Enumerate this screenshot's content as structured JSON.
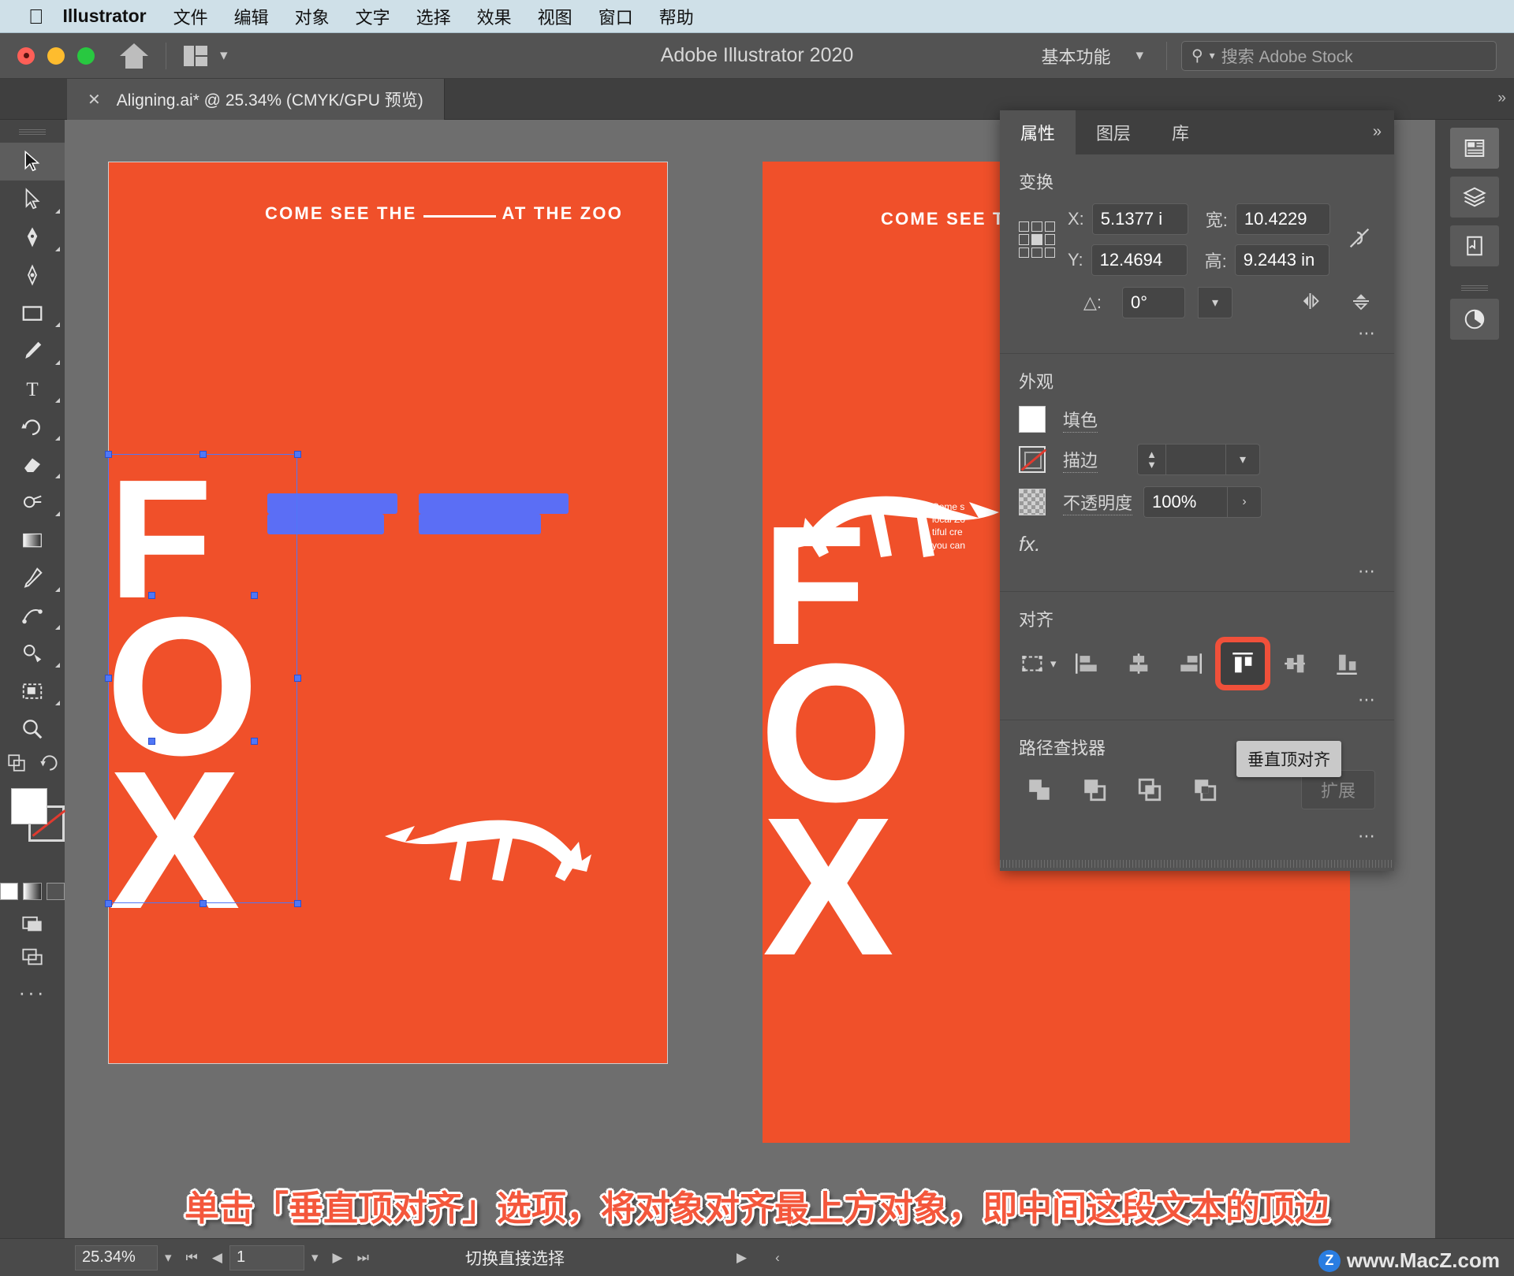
{
  "menubar": {
    "apple_icon": "apple-icon",
    "app_name": "Illustrator",
    "items": [
      "文件",
      "编辑",
      "对象",
      "文字",
      "选择",
      "效果",
      "视图",
      "窗口",
      "帮助"
    ]
  },
  "titlebar": {
    "app_title": "Adobe Illustrator 2020",
    "workspace": "基本功能",
    "search_placeholder": "搜索 Adobe Stock",
    "home_icon": "home-icon",
    "arrange_icon": "arrange-documents-icon",
    "search_icon": "search-icon"
  },
  "tabbar": {
    "document_tab": "Aligning.ai* @ 25.34% (CMYK/GPU 预览)",
    "close_icon": "close-icon"
  },
  "toolbar": {
    "tools": [
      {
        "name": "selection-tool",
        "selected": true
      },
      {
        "name": "direct-selection-tool",
        "selected": false
      },
      {
        "name": "pen-tool",
        "selected": false
      },
      {
        "name": "curvature-tool",
        "selected": false
      },
      {
        "name": "rectangle-tool",
        "selected": false
      },
      {
        "name": "paintbrush-tool",
        "selected": false
      },
      {
        "name": "type-tool",
        "selected": false
      },
      {
        "name": "rotate-tool",
        "selected": false
      },
      {
        "name": "eraser-tool",
        "selected": false
      },
      {
        "name": "shape-builder-tool",
        "selected": false
      },
      {
        "name": "gradient-tool",
        "selected": false
      },
      {
        "name": "eyedropper-tool",
        "selected": false
      },
      {
        "name": "blend-tool",
        "selected": false
      },
      {
        "name": "symbol-sprayer-tool",
        "selected": false
      },
      {
        "name": "artboard-tool",
        "selected": false
      },
      {
        "name": "zoom-tool",
        "selected": false
      }
    ],
    "edit_toolbar_label": "···"
  },
  "canvas": {
    "artboard1": {
      "headline_before": "COME SEE THE",
      "headline_after": "AT THE ZOO",
      "letters": [
        "F",
        "O",
        "X"
      ]
    },
    "artboard2": {
      "headline": "COME SEE TH",
      "letters": [
        "F",
        "O",
        "X"
      ],
      "body_lines": [
        "Come s",
        "local Zo",
        "tiful cre",
        "you can"
      ]
    }
  },
  "properties": {
    "tabs": [
      {
        "label": "属性",
        "active": true
      },
      {
        "label": "图层",
        "active": false
      },
      {
        "label": "库",
        "active": false
      }
    ],
    "more_icon": "chevron-double-right-icon",
    "transform": {
      "title": "变换",
      "x_label": "X:",
      "x_value": "5.1377 i",
      "y_label": "Y:",
      "y_value": "12.4694",
      "w_label": "宽:",
      "w_value": "10.4229",
      "h_label": "高:",
      "h_value": "9.2443 in",
      "angle_label": "△:",
      "angle_value": "0°",
      "link_icon": "link-broken-icon",
      "flip_h_icon": "flip-horizontal-icon",
      "flip_v_icon": "flip-vertical-icon",
      "reference_point_icon": "reference-point-grid-icon",
      "more_icon": "more-options-icon"
    },
    "appearance": {
      "title": "外观",
      "fill_label": "填色",
      "stroke_label": "描边",
      "opacity_label": "不透明度",
      "opacity_value": "100%",
      "fx_label": "fx.",
      "fill_swatch_icon": "fill-swatch-white",
      "stroke_swatch_icon": "stroke-swatch-none",
      "opacity_swatch_icon": "opacity-checker-icon",
      "more_icon": "more-options-icon"
    },
    "align": {
      "title": "对齐",
      "distribute_icon": "align-to-selection-icon",
      "buttons": [
        {
          "name": "align-left-icon",
          "highlighted": false
        },
        {
          "name": "align-horizontal-center-icon",
          "highlighted": false
        },
        {
          "name": "align-right-icon",
          "highlighted": false
        },
        {
          "name": "align-top-icon",
          "highlighted": true
        },
        {
          "name": "align-vertical-center-icon",
          "highlighted": false
        },
        {
          "name": "align-bottom-icon",
          "highlighted": false
        }
      ],
      "tooltip": "垂直顶对齐",
      "more_icon": "more-options-icon"
    },
    "pathfinder": {
      "title": "路径查找器",
      "buttons": [
        "unite-icon",
        "minus-front-icon",
        "intersect-icon",
        "exclude-icon"
      ],
      "expand_label": "扩展",
      "more_icon": "more-options-icon"
    }
  },
  "right_rail": {
    "icons": [
      "properties-panel-icon",
      "layers-panel-icon",
      "libraries-panel-icon",
      "color-guide-icon"
    ],
    "collapse_icon": "chevron-double-right-icon"
  },
  "caption": "单击「垂直顶对齐」选项，将对象对齐最上方对象，即中间这段文本的顶边",
  "statusbar": {
    "zoom_value": "25.34%",
    "zoom_caret": "chevron-down-icon",
    "first_page_icon": "first-page-icon",
    "prev_page_icon": "previous-page-icon",
    "page_value": "1",
    "page_caret": "chevron-down-icon",
    "next_page_icon": "next-page-icon",
    "last_page_icon": "last-page-icon",
    "mode_text": "切换直接选择",
    "mode_next_icon": "play-icon",
    "mode_prev_icon": "chevron-left-icon",
    "watermark": "www.MacZ.com",
    "watermark_logo": "z-logo-icon"
  },
  "colors": {
    "accent_orange": "#f0502a",
    "highlight_red": "#f0503a",
    "selection_blue": "#4f77f7",
    "panel_bg": "#535353",
    "menubar_bg": "#cfe0e8"
  }
}
